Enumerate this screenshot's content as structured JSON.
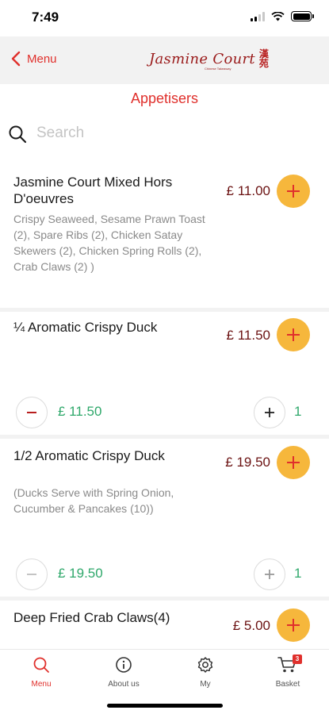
{
  "status_bar": {
    "time": "7:49"
  },
  "nav": {
    "back_label": "Menu",
    "logo_text": "Jasmine Court",
    "logo_seal": "漢\n苑",
    "logo_sub": "Chinese Takeaway"
  },
  "page_title": "Appetisers",
  "search": {
    "placeholder": "Search",
    "value": ""
  },
  "items": [
    {
      "name": "Jasmine Court Mixed Hors D'oeuvres",
      "description": "Crispy Seaweed, Sesame Prawn Toast (2), Spare Ribs (2), Chicken Satay Skewers (2), Chicken Spring Rolls (2), Crab Claws (2) )",
      "price": "£ 11.00"
    },
    {
      "name": "¼ Aromatic Crispy Duck",
      "description": "",
      "price": "£ 11.50",
      "in_basket": {
        "price": "£ 11.50",
        "quantity": "1"
      }
    },
    {
      "name": "1/2 Aromatic Crispy Duck",
      "description": "(Ducks Serve with Spring Onion, Cucumber & Pancakes (10))",
      "price": "£ 19.50",
      "in_basket": {
        "price": "£ 19.50",
        "quantity": "1"
      }
    },
    {
      "name": "Deep Fried Crab Claws(4)",
      "description": "",
      "price": "£ 5.00"
    }
  ],
  "tabs": [
    {
      "label": "Menu",
      "icon": "search-icon",
      "active": true
    },
    {
      "label": "About us",
      "icon": "info-icon",
      "active": false
    },
    {
      "label": "My",
      "icon": "gear-icon",
      "active": false
    },
    {
      "label": "Basket",
      "icon": "cart-icon",
      "active": false,
      "badge": "3"
    }
  ],
  "colors": {
    "accent": "#e0302c",
    "add_button": "#f6b73c",
    "price": "#6b1212",
    "basket_price": "#2fa86b",
    "logo": "#9a1b1b"
  }
}
